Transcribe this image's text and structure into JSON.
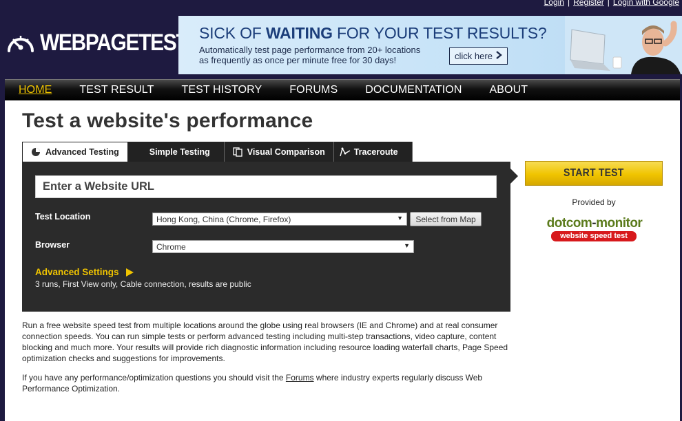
{
  "auth": {
    "login": "Login",
    "register": "Register",
    "login_google": "Login with Google",
    "separator": "|"
  },
  "logo": {
    "text": "WEBPAGETEST",
    "icon": "speedometer-icon"
  },
  "banner": {
    "headline_normal_1": "SICK OF ",
    "headline_bold": "WAITING",
    "headline_normal_2": " FOR YOUR TEST RESULTS?",
    "line1": "Automatically test page performance from 20+ locations",
    "line2": "as frequently as once per minute free for 30 days!",
    "button": "click here",
    "button_icon": "chevron-right-icon"
  },
  "nav": {
    "items": [
      {
        "label": "HOME",
        "active": true
      },
      {
        "label": "TEST RESULT",
        "active": false
      },
      {
        "label": "TEST HISTORY",
        "active": false
      },
      {
        "label": "FORUMS",
        "active": false
      },
      {
        "label": "DOCUMENTATION",
        "active": false
      },
      {
        "label": "ABOUT",
        "active": false
      }
    ]
  },
  "page": {
    "title": "Test a website's performance"
  },
  "tabs": [
    {
      "label": "Advanced Testing",
      "icon": "gauge-icon",
      "active": true
    },
    {
      "label": "Simple Testing",
      "icon": "",
      "active": false
    },
    {
      "label": "Visual Comparison",
      "icon": "compare-icon",
      "active": false
    },
    {
      "label": "Traceroute",
      "icon": "traceroute-icon",
      "active": false
    }
  ],
  "form": {
    "url_placeholder": "Enter a Website URL",
    "url_value": "",
    "location_label": "Test Location",
    "location_value": "Hong Kong, China (Chrome, Firefox)",
    "map_button": "Select from Map",
    "browser_label": "Browser",
    "browser_value": "Chrome",
    "advanced_label": "Advanced Settings",
    "advanced_summary": "3 runs, First View only, Cable connection, results are public"
  },
  "sidebar": {
    "start_button": "START TEST",
    "provided_by": "Provided by",
    "sponsor_name_1": "dotcom",
    "sponsor_dash": "-",
    "sponsor_name_2": "monitor",
    "sponsor_tagline": "website speed test"
  },
  "description": {
    "para1": "Run a free website speed test from multiple locations around the globe using real browsers (IE and Chrome) and at real consumer connection speeds. You can run simple tests or perform advanced testing including multi-step transactions, video capture, content blocking and much more. Your results will provide rich diagnostic information including resource loading waterfall charts, Page Speed optimization checks and suggestions for improvements.",
    "para2_before": "If you have any performance/optimization questions you should visit the ",
    "para2_link": "Forums",
    "para2_after": " where industry experts regularly discuss Web Performance Optimization."
  },
  "colors": {
    "background": "#1e1a40",
    "accent_yellow": "#f0c400",
    "panel_dark": "#2b2b2b",
    "banner_blue": "#1c3e7a",
    "sponsor_green": "#5b7b1c",
    "sponsor_red": "#d7191c"
  }
}
